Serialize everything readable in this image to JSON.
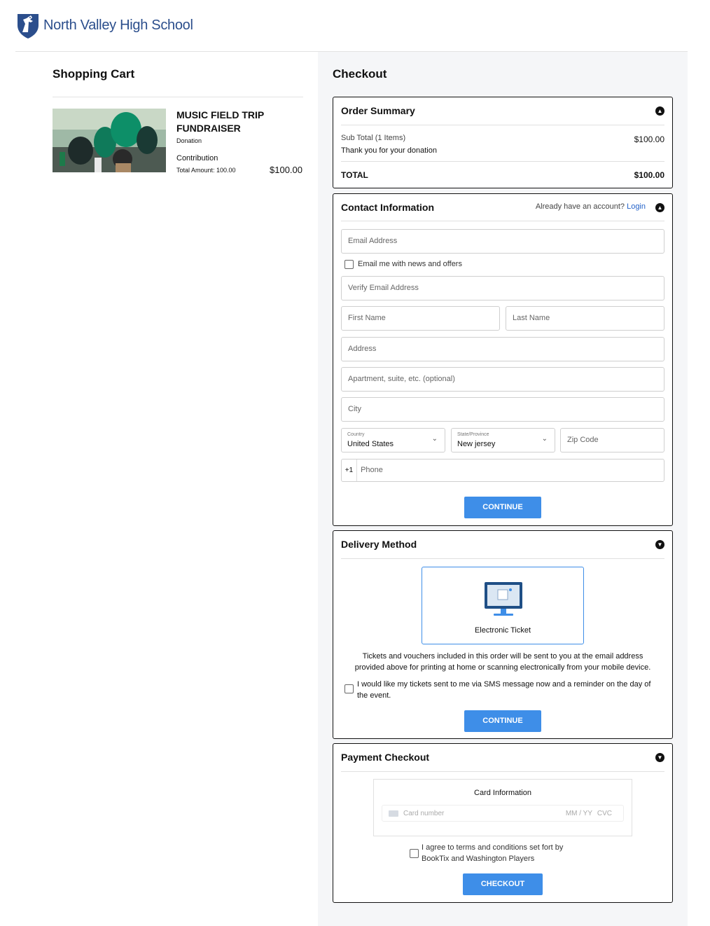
{
  "header": {
    "school_name": "North Valley High School"
  },
  "cart": {
    "title": "Shopping Cart",
    "item": {
      "title": "MUSIC FIELD TRIP FUNDRAISER",
      "type": "Donation",
      "line_label": "Contribution",
      "total_label": "Total Amount: 100.00",
      "price": "$100.00"
    }
  },
  "checkout": {
    "title": "Checkout",
    "order_summary": {
      "heading": "Order Summary",
      "subtotal_label": "Sub Total (1 Items)",
      "subtotal_value": "$100.00",
      "thanks": "Thank you for your donation",
      "total_label": "TOTAL",
      "total_value": "$100.00"
    },
    "contact": {
      "heading": "Contact Information",
      "account_prompt": "Already have an account?",
      "login_link": "Login",
      "email_placeholder": "Email Address",
      "news_label": "Email me with news and offers",
      "verify_placeholder": "Verify Email Address",
      "first_placeholder": "First Name",
      "last_placeholder": "Last Name",
      "address_placeholder": "Address",
      "apt_placeholder": "Apartment, suite, etc. (optional)",
      "city_placeholder": "City",
      "country_label": "Country",
      "country_value": "United States",
      "state_label": "State/Province",
      "state_value": "New jersey",
      "zip_placeholder": "Zip Code",
      "phone_prefix": "+1",
      "phone_placeholder": "Phone",
      "continue_label": "CONTINUE"
    },
    "delivery": {
      "heading": "Delivery Method",
      "option_label": "Electronic Ticket",
      "info_text_1": "Tickets and vouchers included in this order will be sent to you at the email address",
      "info_text_2": "provided above for printing at home or scanning electronically from your mobile device.",
      "sms_label_1": "I would like my tickets sent to me via SMS message now and a reminder on the day of",
      "sms_label_2": "the event.",
      "continue_label": "CONTINUE"
    },
    "payment": {
      "heading": "Payment Checkout",
      "card_info_label": "Card Information",
      "card_number_placeholder": "Card number",
      "card_expiry_placeholder": "MM / YY",
      "card_cvc_placeholder": "CVC",
      "terms_1": "I agree to terms and conditions set fort by",
      "terms_2": "BookTix and Washington Players",
      "checkout_label": "CHECKOUT"
    }
  },
  "colors": {
    "accent": "#3e8ee8",
    "brand": "#2b4e8c",
    "link": "#2563c9"
  }
}
